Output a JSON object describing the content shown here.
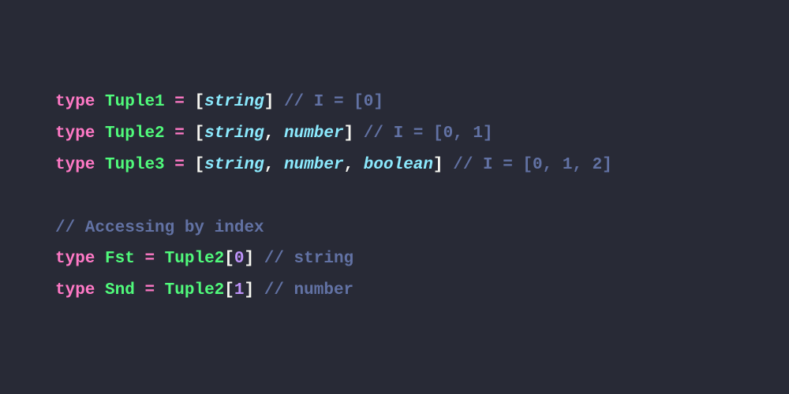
{
  "lines": {
    "l1": {
      "kw": "type",
      "name": "Tuple1",
      "eq": "=",
      "open": "[",
      "t1": "string",
      "close": "]",
      "comment": "// I = [0]"
    },
    "l2": {
      "kw": "type",
      "name": "Tuple2",
      "eq": "=",
      "open": "[",
      "t1": "string",
      "c1": ",",
      "t2": "number",
      "close": "]",
      "comment": "// I = [0, 1]"
    },
    "l3": {
      "kw": "type",
      "name": "Tuple3",
      "eq": "=",
      "open": "[",
      "t1": "string",
      "c1": ",",
      "t2": "number",
      "c2": ",",
      "t3": "boolean",
      "close": "]",
      "comment": "// I = [0, 1, 2]"
    },
    "l4": {
      "comment": "// Accessing by index"
    },
    "l5": {
      "kw": "type",
      "name": "Fst",
      "eq": "=",
      "ref": "Tuple2",
      "open": "[",
      "idx": "0",
      "close": "]",
      "comment": "// string"
    },
    "l6": {
      "kw": "type",
      "name": "Snd",
      "eq": "=",
      "ref": "Tuple2",
      "open": "[",
      "idx": "1",
      "close": "]",
      "comment": "// number"
    }
  }
}
